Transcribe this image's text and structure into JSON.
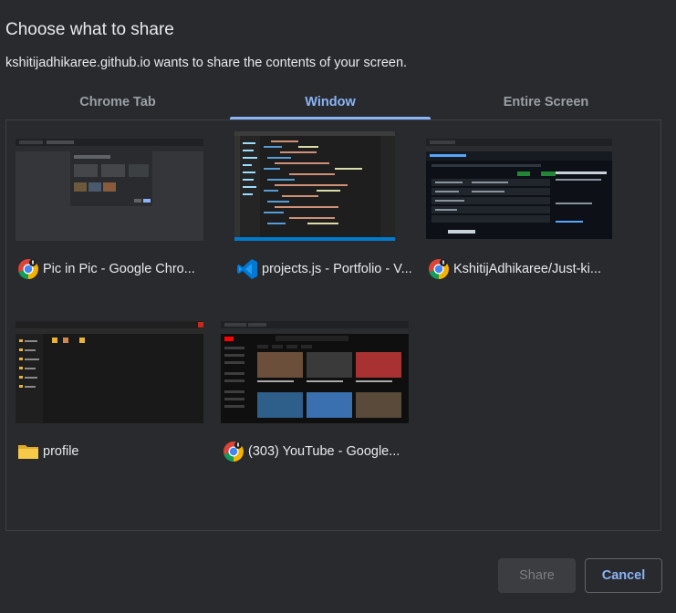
{
  "dialog": {
    "title": "Choose what to share",
    "subtitle": "kshitijadhikaree.github.io wants to share the contents of your screen."
  },
  "tabs": [
    {
      "label": "Chrome Tab",
      "active": false
    },
    {
      "label": "Window",
      "active": true
    },
    {
      "label": "Entire Screen",
      "active": false
    }
  ],
  "windows": [
    {
      "label": "Pic in Pic - Google Chro...",
      "icon": "chrome-icon"
    },
    {
      "label": "projects.js - Portfolio - V...",
      "icon": "vscode-icon"
    },
    {
      "label": "KshitijAdhikaree/Just-ki...",
      "icon": "chrome-icon"
    },
    {
      "label": "profile",
      "icon": "folder-icon"
    },
    {
      "label": "(303) YouTube - Google...",
      "icon": "chrome-icon"
    }
  ],
  "buttons": {
    "share": "Share",
    "cancel": "Cancel"
  },
  "colors": {
    "background": "#292a2d",
    "accent": "#8ab4f8",
    "text": "#e8eaed",
    "muted": "#9aa0a6"
  }
}
